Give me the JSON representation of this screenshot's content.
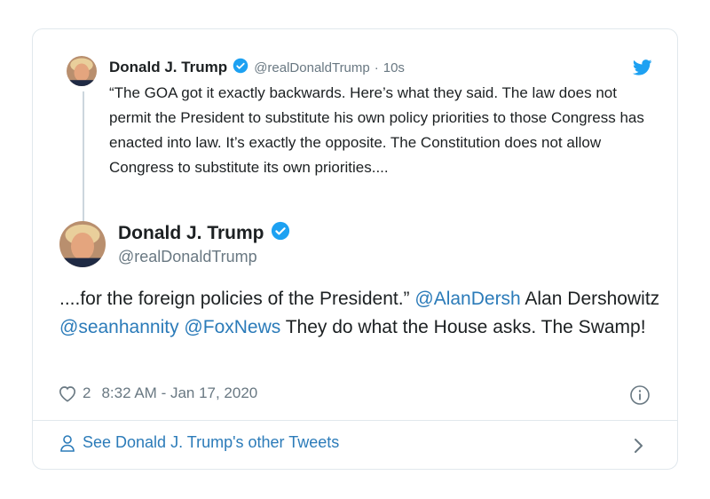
{
  "quoted_tweet": {
    "author_name": "Donald J. Trump",
    "handle": "@realDonaldTrump",
    "separator": "·",
    "time_ago": "10s",
    "text": "“The GOA got it exactly backwards. Here’s what they said. The law does not permit the President to substitute his own policy priorities to those Congress has enacted into law. It’s exactly the opposite. The Constitution does not allow Congress to substitute its own priorities...."
  },
  "main_tweet": {
    "author_name": "Donald J. Trump",
    "handle": "@realDonaldTrump",
    "text_parts": {
      "t1": "....for the foreign policies of the President.” ",
      "m1": "@AlanDersh",
      "t2": " Alan Dershowitz ",
      "m2": "@seanhannity",
      "t3": " ",
      "m3": "@FoxNews",
      "t4": "  They do what the House asks. The Swamp!"
    },
    "like_count": "2",
    "timestamp": "8:32 AM - Jan 17, 2020"
  },
  "footer": {
    "link_label": "See Donald J. Trump's other Tweets"
  },
  "icons": {
    "verified": "verified-badge-icon",
    "twitter": "twitter-bird-icon",
    "heart": "heart-icon",
    "info": "info-icon",
    "person": "person-icon",
    "chevron": "chevron-right-icon"
  },
  "colors": {
    "link": "#2b7bb9",
    "verified": "#1da1f2",
    "muted": "#697882",
    "border": "#e1e8ed"
  }
}
